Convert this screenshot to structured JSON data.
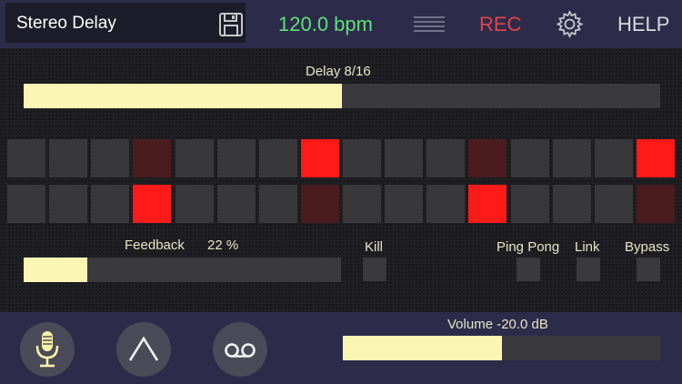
{
  "header": {
    "preset_name": "Stereo Delay",
    "save_icon": "floppy-disk-icon",
    "bpm": "120.0 bpm",
    "menu_icon": "hamburger-lines-icon",
    "rec": "REC",
    "settings_icon": "gear-icon",
    "help": "HELP",
    "colors": {
      "bpm": "#5fe07a",
      "rec": "#e0444c"
    }
  },
  "delay": {
    "label": "Delay  8/16",
    "level": 0.5
  },
  "sequencer": {
    "steps": 16,
    "rows": [
      {
        "states": [
          "off",
          "off",
          "off",
          "dim",
          "off",
          "off",
          "off",
          "on",
          "off",
          "off",
          "off",
          "dim",
          "off",
          "off",
          "off",
          "on"
        ]
      },
      {
        "states": [
          "off",
          "off",
          "off",
          "on",
          "off",
          "off",
          "off",
          "dim",
          "off",
          "off",
          "off",
          "on",
          "off",
          "off",
          "off",
          "dim"
        ]
      }
    ],
    "colors": {
      "on": "#ff1a1a",
      "dim": "#4a1c1e",
      "off": "#38383a"
    }
  },
  "feedback": {
    "label": "Feedback",
    "value": "22 %",
    "level": 0.2
  },
  "toggles": {
    "kill": "Kill",
    "ping_pong": "Ping Pong",
    "link": "Link",
    "bypass": "Bypass"
  },
  "footer": {
    "buttons": [
      "microphone-icon",
      "caret-up-icon",
      "cassette-tape-icon"
    ],
    "volume_label": "Volume -20.0 dB",
    "volume_level": 0.5
  }
}
